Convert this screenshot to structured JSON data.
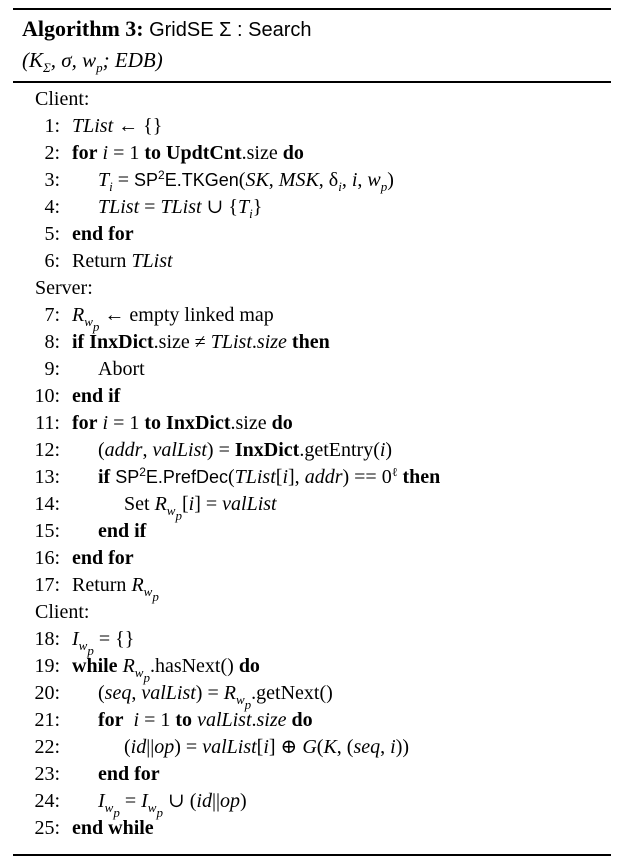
{
  "algorithm": {
    "number_label": "Algorithm 3:",
    "name": "GridSE Σ : Search",
    "params": "(K_Σ, σ, w_p; EDB)"
  },
  "sections": [
    "Client:",
    "Server:",
    "Client:"
  ],
  "lines": [
    {
      "n": "1:",
      "text": "TList ← {}"
    },
    {
      "n": "2:",
      "text": "for i = 1 to UpdtCnt.size do"
    },
    {
      "n": "3:",
      "text": "T_i = SP²E.TKGen(SK, MSK, δ_i, i, w_p)"
    },
    {
      "n": "4:",
      "text": "TList = TList ∪ {T_i}"
    },
    {
      "n": "5:",
      "text": "end for"
    },
    {
      "n": "6:",
      "text": "Return TList"
    },
    {
      "n": "7:",
      "text": "R_wp ← empty linked map"
    },
    {
      "n": "8:",
      "text": "if InxDict.size ≠ TList.size then"
    },
    {
      "n": "9:",
      "text": "Abort"
    },
    {
      "n": "10:",
      "text": "end if"
    },
    {
      "n": "11:",
      "text": "for i = 1 to InxDict.size do"
    },
    {
      "n": "12:",
      "text": "(addr, valList) = InxDict.getEntry(i)"
    },
    {
      "n": "13:",
      "text": "if SP²E.PrefDec(TList[i], addr) == 0^ℓ then"
    },
    {
      "n": "14:",
      "text": "Set R_wp[i] = valList"
    },
    {
      "n": "15:",
      "text": "end if"
    },
    {
      "n": "16:",
      "text": "end for"
    },
    {
      "n": "17:",
      "text": "Return R_wp"
    },
    {
      "n": "18:",
      "text": "I_wp = {}"
    },
    {
      "n": "19:",
      "text": "while R_wp.hasNext() do"
    },
    {
      "n": "20:",
      "text": "(seq, valList) = R_wp.getNext()"
    },
    {
      "n": "21:",
      "text": "for i = 1 to valList.size do"
    },
    {
      "n": "22:",
      "text": "(id||op) = valList[i] ⊕ G(K, (seq, i))"
    },
    {
      "n": "23:",
      "text": "end for"
    },
    {
      "n": "24:",
      "text": "I_wp = I_wp ∪ (id||op)"
    },
    {
      "n": "25:",
      "text": "end while"
    }
  ]
}
